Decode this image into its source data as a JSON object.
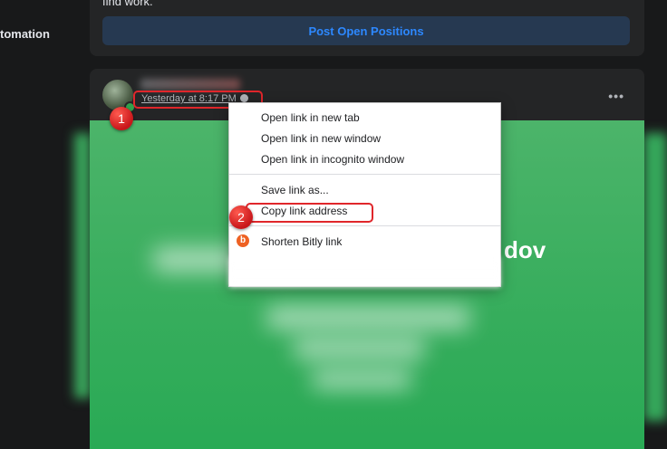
{
  "sidebar": {
    "partial_item": "tomation"
  },
  "top_card": {
    "snippet": "find work.",
    "post_open_positions_label": "Post Open Positions"
  },
  "post": {
    "timestamp": "Yesterday at 8:17 PM · ",
    "more_label": "•••",
    "image_text_partial": "dov"
  },
  "context_menu": {
    "items": [
      {
        "label": "Open link in new tab"
      },
      {
        "label": "Open link in new window"
      },
      {
        "label": "Open link in incognito window"
      },
      {
        "label": "Save link as..."
      },
      {
        "label": "Copy link address"
      },
      {
        "label": "Shorten Bitly link",
        "icon": "bitly-icon"
      }
    ],
    "bitly_glyph": "b"
  },
  "annotations": {
    "step1": "1",
    "step2": "2",
    "highlight_color": "#e0262b"
  },
  "colors": {
    "page_bg": "#18191a",
    "card_bg": "#242526",
    "accent": "#2d88ff",
    "image_green": "#36ad5c"
  }
}
